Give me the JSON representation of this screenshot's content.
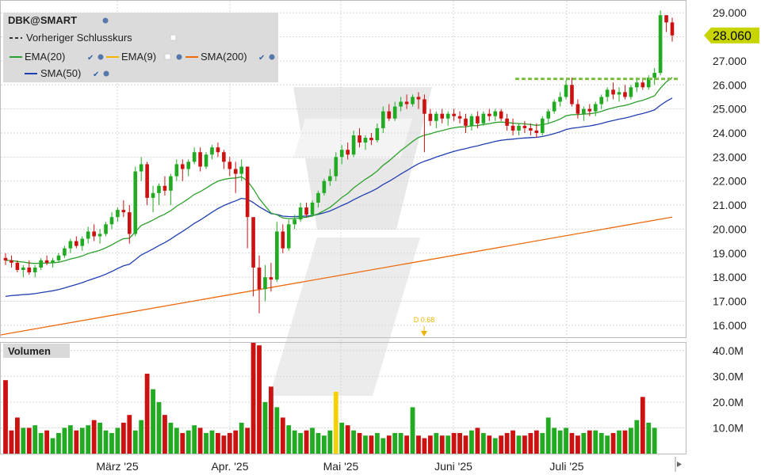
{
  "chart_data": [
    {
      "type": "candlestick",
      "title": "DBK@SMART",
      "legend": {
        "placement": "top-left",
        "items": [
          {
            "label": "Vorheriger Schlusskurs",
            "style": "dashed",
            "color": "#333333"
          },
          {
            "label": "EMA(20)",
            "color": "#2ca02c"
          },
          {
            "label": "EMA(9)",
            "color": "#f0b400"
          },
          {
            "label": "SMA(200)",
            "color": "#ee6a0c"
          },
          {
            "label": "SMA(50)",
            "color": "#1f3fb0"
          }
        ]
      },
      "y_ticks": [
        "29.000",
        "28.000",
        "27.000",
        "26.000",
        "25.000",
        "24.000",
        "23.000",
        "22.000",
        "21.000",
        "20.000",
        "19.000",
        "18.000",
        "17.000",
        "16.000"
      ],
      "ylim": [
        15500,
        29500
      ],
      "current_price": "28.060",
      "current_value": 28060,
      "previous_close": 26250,
      "x_ticks": [
        "März '25",
        "Apr. '25",
        "Mai '25",
        "Juni '25",
        "Juli '25"
      ],
      "dividend_annotation": "D 0.68",
      "ohlc": [
        [
          18800,
          19000,
          18500,
          18700
        ],
        [
          18700,
          18900,
          18400,
          18600
        ],
        [
          18600,
          18700,
          18200,
          18300
        ],
        [
          18300,
          18500,
          18000,
          18400
        ],
        [
          18400,
          18700,
          18100,
          18200
        ],
        [
          18200,
          18500,
          18000,
          18400
        ],
        [
          18400,
          18800,
          18300,
          18700
        ],
        [
          18700,
          18900,
          18500,
          18600
        ],
        [
          18600,
          18800,
          18400,
          18700
        ],
        [
          18700,
          19000,
          18600,
          18900
        ],
        [
          18900,
          19300,
          18800,
          19200
        ],
        [
          19200,
          19600,
          19000,
          19500
        ],
        [
          19500,
          19700,
          19200,
          19300
        ],
        [
          19300,
          19700,
          19100,
          19600
        ],
        [
          19600,
          20100,
          19400,
          19900
        ],
        [
          19900,
          20200,
          19500,
          19700
        ],
        [
          19700,
          20000,
          19400,
          19800
        ],
        [
          19800,
          20300,
          19700,
          20200
        ],
        [
          20200,
          20700,
          20000,
          20500
        ],
        [
          20500,
          20900,
          20300,
          20800
        ],
        [
          20800,
          21200,
          20500,
          20700
        ],
        [
          20700,
          21000,
          19400,
          19800
        ],
        [
          19800,
          22600,
          19700,
          22400
        ],
        [
          22400,
          23000,
          22000,
          22700
        ],
        [
          22700,
          22800,
          21000,
          21300
        ],
        [
          21300,
          21800,
          20700,
          21500
        ],
        [
          21500,
          21900,
          21000,
          21800
        ],
        [
          21800,
          22200,
          21400,
          21600
        ],
        [
          21600,
          22300,
          21000,
          22200
        ],
        [
          22200,
          22900,
          22000,
          22700
        ],
        [
          22700,
          22900,
          22000,
          22500
        ],
        [
          22500,
          22900,
          22200,
          22800
        ],
        [
          22800,
          23400,
          22700,
          23200
        ],
        [
          23200,
          23400,
          22400,
          22600
        ],
        [
          22600,
          23200,
          22500,
          23100
        ],
        [
          23100,
          23500,
          22900,
          23400
        ],
        [
          23400,
          23600,
          23000,
          23200
        ],
        [
          23200,
          23300,
          22500,
          22800
        ],
        [
          22800,
          23000,
          22200,
          22500
        ],
        [
          22500,
          22800,
          21500,
          22300
        ],
        [
          22300,
          22900,
          22000,
          22600
        ],
        [
          22600,
          22500,
          19200,
          20500
        ],
        [
          20500,
          19900,
          17200,
          18400
        ],
        [
          18400,
          18900,
          16500,
          17500
        ],
        [
          17500,
          18500,
          17000,
          18000
        ],
        [
          18000,
          18600,
          17400,
          17900
        ],
        [
          17900,
          20300,
          17800,
          19900
        ],
        [
          19900,
          20200,
          19000,
          19200
        ],
        [
          19200,
          20400,
          19100,
          20200
        ],
        [
          20200,
          20600,
          20000,
          20400
        ],
        [
          20400,
          21100,
          20300,
          20900
        ],
        [
          20900,
          21100,
          20500,
          20600
        ],
        [
          20600,
          21200,
          20500,
          21100
        ],
        [
          21100,
          21600,
          20900,
          21500
        ],
        [
          21500,
          22100,
          21400,
          22000
        ],
        [
          22000,
          22500,
          21800,
          22200
        ],
        [
          22200,
          23200,
          22000,
          23000
        ],
        [
          23000,
          23500,
          22700,
          23300
        ],
        [
          23300,
          23600,
          22900,
          23100
        ],
        [
          23100,
          24100,
          23000,
          23900
        ],
        [
          23900,
          24200,
          23400,
          23600
        ],
        [
          23600,
          23900,
          23300,
          23800
        ],
        [
          23800,
          24000,
          23500,
          23700
        ],
        [
          23700,
          24400,
          23600,
          24200
        ],
        [
          24200,
          25100,
          24000,
          24900
        ],
        [
          24900,
          25200,
          24500,
          24600
        ],
        [
          24600,
          25300,
          24500,
          25100
        ],
        [
          25100,
          25500,
          24900,
          25300
        ],
        [
          25300,
          25600,
          25000,
          25200
        ],
        [
          25200,
          25600,
          25100,
          25500
        ],
        [
          25500,
          25700,
          25000,
          25400
        ],
        [
          25400,
          25600,
          23200,
          24800
        ],
        [
          24800,
          25000,
          24300,
          24500
        ],
        [
          24500,
          24900,
          24200,
          24800
        ],
        [
          24800,
          25000,
          24400,
          24600
        ],
        [
          24600,
          24900,
          24300,
          24800
        ],
        [
          24800,
          25000,
          24500,
          24700
        ],
        [
          24700,
          24900,
          24400,
          24600
        ],
        [
          24600,
          24800,
          24000,
          24300
        ],
        [
          24300,
          24800,
          24100,
          24700
        ],
        [
          24700,
          24900,
          24200,
          24400
        ],
        [
          24400,
          24900,
          24300,
          24800
        ],
        [
          24800,
          25000,
          24500,
          24700
        ],
        [
          24700,
          25000,
          24500,
          24900
        ],
        [
          24900,
          25000,
          24500,
          24600
        ],
        [
          24600,
          24800,
          24100,
          24300
        ],
        [
          24300,
          24600,
          23900,
          24100
        ],
        [
          24100,
          24400,
          23900,
          24300
        ],
        [
          24300,
          24500,
          24000,
          24200
        ],
        [
          24200,
          24400,
          23900,
          24100
        ],
        [
          24100,
          24400,
          23800,
          24000
        ],
        [
          24000,
          24700,
          23900,
          24600
        ],
        [
          24600,
          25000,
          24400,
          24900
        ],
        [
          24900,
          25400,
          24800,
          25300
        ],
        [
          25300,
          25700,
          25100,
          25500
        ],
        [
          25500,
          26200,
          25400,
          26000
        ],
        [
          26000,
          26300,
          25100,
          25200
        ],
        [
          25200,
          25400,
          24600,
          24800
        ],
        [
          24800,
          25100,
          24500,
          25000
        ],
        [
          25000,
          25200,
          24700,
          24900
        ],
        [
          24900,
          25300,
          24700,
          25200
        ],
        [
          25200,
          25600,
          25000,
          25500
        ],
        [
          25500,
          25900,
          25300,
          25800
        ],
        [
          25800,
          26100,
          25400,
          25600
        ],
        [
          25600,
          25900,
          25300,
          25700
        ],
        [
          25700,
          26000,
          25400,
          25500
        ],
        [
          25500,
          26000,
          25400,
          25900
        ],
        [
          25900,
          26300,
          25700,
          26100
        ],
        [
          26100,
          26200,
          25800,
          25900
        ],
        [
          25900,
          26400,
          25800,
          26300
        ],
        [
          26300,
          26700,
          26000,
          26500
        ],
        [
          26500,
          29100,
          26400,
          28900
        ],
        [
          28900,
          28900,
          28200,
          28600
        ],
        [
          28600,
          28800,
          27800,
          28060
        ]
      ],
      "volume": {
        "title": "Volumen",
        "y_ticks": [
          "40.0M",
          "30.0M",
          "20.0M",
          "10.0M"
        ],
        "ylim": [
          0,
          43000000
        ],
        "values": [
          28500000,
          9000000,
          14000000,
          10000000,
          10000000,
          11000000,
          8000000,
          9000000,
          6000000,
          8000000,
          10000000,
          11000000,
          9000000,
          10000000,
          11000000,
          13000000,
          12000000,
          9000000,
          8000000,
          10000000,
          12000000,
          15000000,
          9000000,
          13000000,
          31000000,
          25000000,
          20000000,
          15000000,
          12000000,
          10000000,
          8000000,
          9000000,
          11000000,
          10000000,
          8000000,
          9000000,
          8000000,
          7000000,
          8000000,
          9000000,
          12000000,
          10000000,
          43000000,
          42000000,
          20000000,
          26000000,
          18000000,
          14000000,
          11000000,
          9000000,
          8000000,
          9000000,
          10000000,
          8000000,
          7000000,
          9000000,
          24000000,
          12000000,
          11000000,
          9000000,
          8000000,
          7000000,
          7000000,
          8000000,
          6000000,
          7000000,
          8000000,
          8000000,
          7000000,
          18000000,
          7000000,
          6000000,
          7000000,
          8000000,
          7000000,
          7000000,
          8000000,
          8000000,
          7000000,
          9000000,
          10000000,
          8000000,
          7000000,
          6000000,
          7000000,
          8000000,
          9000000,
          7000000,
          7000000,
          8000000,
          9000000,
          8000000,
          14000000,
          10000000,
          9000000,
          10000000,
          8000000,
          7000000,
          8000000,
          9000000,
          9000000,
          8000000,
          7000000,
          8000000,
          9000000,
          9000000,
          10000000,
          13000000,
          22000000,
          12000000,
          10000000
        ],
        "highlight_index": 56,
        "highlight_color": "#f5d100"
      }
    }
  ],
  "colors": {
    "up": "#22aa22",
    "down": "#cc1111",
    "grid": "#d6d6d6",
    "watermark": "#e6e6e6",
    "price_tag_bg": "#c8d400",
    "dividend": "#e8b400"
  },
  "ui": {
    "scroll_arrow": "arrow-right-icon"
  }
}
